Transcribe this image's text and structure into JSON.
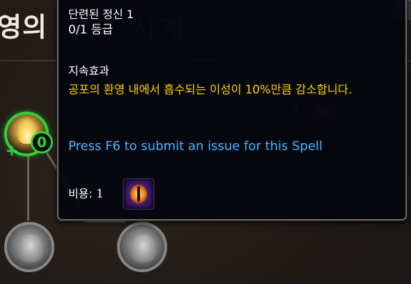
{
  "background_panel": {
    "title": "영의",
    "title_faded": "시계",
    "active_talent": {
      "rank": "0",
      "add_symbol": "+",
      "icon": "flame-eye-icon"
    },
    "locked_talents": [
      {
        "icon": "hooded-figure-icon"
      },
      {
        "icon": "ghostly-face-icon"
      }
    ],
    "cost_preview": {
      "amount": "1",
      "icon": "void-eye-icon"
    }
  },
  "tooltip": {
    "name": "단련된 정신 1",
    "rank": "0/1 등급",
    "section_label": "지속효과",
    "description": "공포의 환영 내에서 흡수되는 이성이 10%만큼 감소합니다.",
    "issue_link": "Press F6 to submit an issue for this Spell",
    "cost_label": "비용:",
    "cost_amount": "1",
    "cost_icon": "void-eye-icon",
    "colors": {
      "description": "#ffd200",
      "link": "#4cb2ff",
      "text": "#ffffff",
      "active_ring": "#2fd23a"
    }
  }
}
